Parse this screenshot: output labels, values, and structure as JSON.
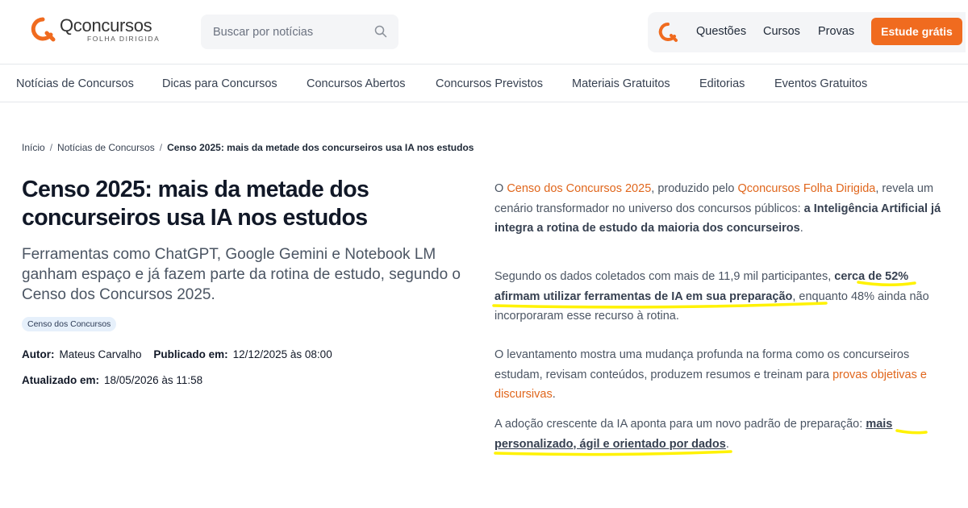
{
  "header": {
    "logo_name": "Qconcursos",
    "logo_sub": "FOLHA DIRIGIDA",
    "search_placeholder": "Buscar por notícias",
    "links": [
      "Questões",
      "Cursos",
      "Provas"
    ],
    "cta": "Estude grátis",
    "brand_color": "#f06b1f"
  },
  "nav": {
    "items": [
      "Notícias de Concursos",
      "Dicas para Concursos",
      "Concursos Abertos",
      "Concursos Previstos",
      "Materiais Gratuitos",
      "Editorias",
      "Eventos Gratuitos"
    ]
  },
  "breadcrumb": {
    "home": "Início",
    "section": "Notícias de Concursos",
    "current": "Censo 2025: mais da metade dos concurseiros usa IA nos estudos"
  },
  "article": {
    "title": "Censo 2025: mais da metade dos concurseiros usa IA nos estudos",
    "subtitle": "Ferramentas como ChatGPT, Google Gemini e Notebook LM ganham espaço e já fazem parte da rotina de estudo, segundo o Censo dos Concursos 2025.",
    "tag": "Censo dos Concursos",
    "author_label": "Autor:",
    "author": "Mateus Carvalho",
    "published_label": "Publicado em:",
    "published": "12/12/2025 às 08:00",
    "updated_label": "Atualizado em:",
    "updated": "18/05/2026 às 11:58",
    "p1": {
      "a": "O ",
      "link1": "Censo dos Concursos 2025",
      "b": ", produzido pelo ",
      "link2": "Qconcursos Folha Dirigida",
      "c": ", revela um cenário transformador no universo dos concursos públicos: ",
      "bold": "a Inteligência Artificial já integra a rotina de estudo da maioria dos concurseiros",
      "d": "."
    },
    "p2": {
      "a": "Segundo os dados coletados com mais de 11,9 mil participantes, ",
      "bold": "cerca de 52% afirmam utilizar ferramentas de IA em sua preparação",
      "b": ", enquanto 48% ainda não incorporaram esse recurso à rotina."
    },
    "p3": {
      "a": "O levantamento mostra uma mudança profunda na forma como os concurseiros estudam, revisam conteúdos, produzem resumos e treinam para ",
      "link": "provas objetivas e discursivas",
      "b": "."
    },
    "p4": {
      "a": "A adoção crescente da IA aponta para um novo padrão de preparação: ",
      "link": "mais personalizado, ágil e orientado por dados",
      "b": "."
    }
  }
}
